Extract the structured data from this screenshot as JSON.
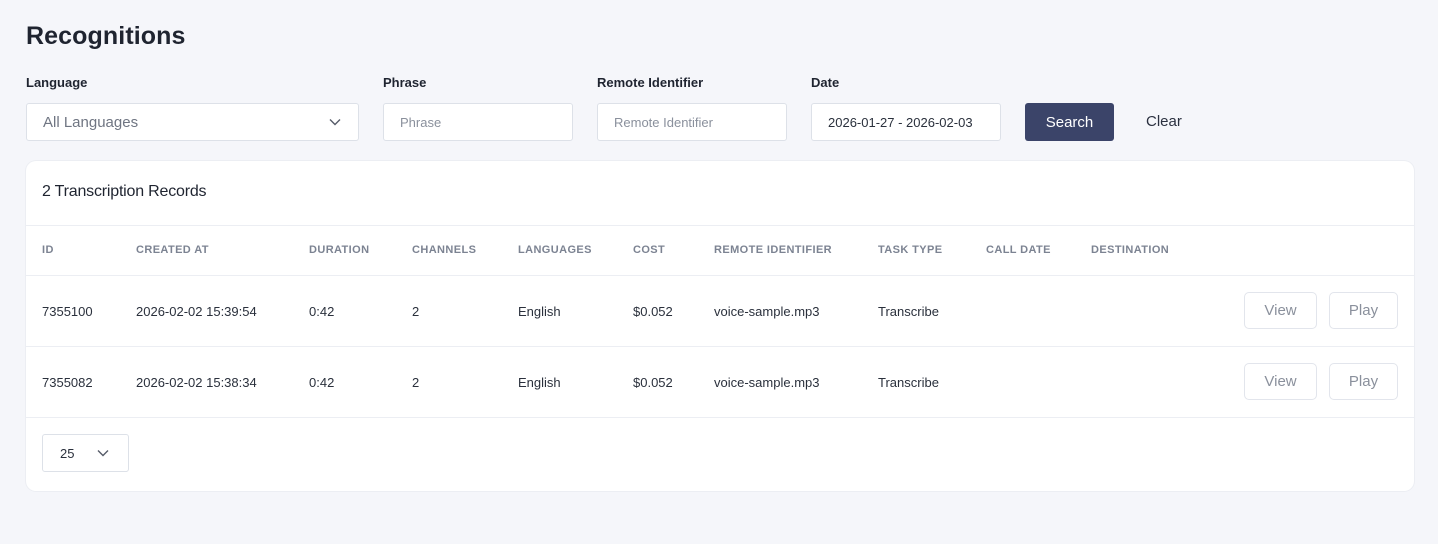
{
  "page": {
    "title": "Recognitions"
  },
  "filters": {
    "language": {
      "label": "Language",
      "value": "All Languages"
    },
    "phrase": {
      "label": "Phrase",
      "placeholder": "Phrase"
    },
    "remote_identifier": {
      "label": "Remote Identifier",
      "placeholder": "Remote Identifier"
    },
    "date": {
      "label": "Date",
      "value": "2026-01-27 - 2026-02-03"
    },
    "search_label": "Search",
    "clear_label": "Clear"
  },
  "records": {
    "title": "2 Transcription Records",
    "columns": [
      "ID",
      "CREATED AT",
      "DURATION",
      "CHANNELS",
      "LANGUAGES",
      "COST",
      "REMOTE IDENTIFIER",
      "TASK TYPE",
      "CALL DATE",
      "DESTINATION"
    ],
    "rows": [
      {
        "id": "7355100",
        "created_at": "2026-02-02 15:39:54",
        "duration": "0:42",
        "channels": "2",
        "languages": "English",
        "cost": "$0.052",
        "remote_identifier": "voice-sample.mp3",
        "task_type": "Transcribe",
        "call_date": "",
        "destination": ""
      },
      {
        "id": "7355082",
        "created_at": "2026-02-02 15:38:34",
        "duration": "0:42",
        "channels": "2",
        "languages": "English",
        "cost": "$0.052",
        "remote_identifier": "voice-sample.mp3",
        "task_type": "Transcribe",
        "call_date": "",
        "destination": ""
      }
    ],
    "view_label": "View",
    "play_label": "Play",
    "page_size": "25"
  },
  "icons": {
    "dropdown": "chevron-down-icon"
  },
  "colors": {
    "primary": "#3b4469",
    "background": "#f5f6fa"
  }
}
